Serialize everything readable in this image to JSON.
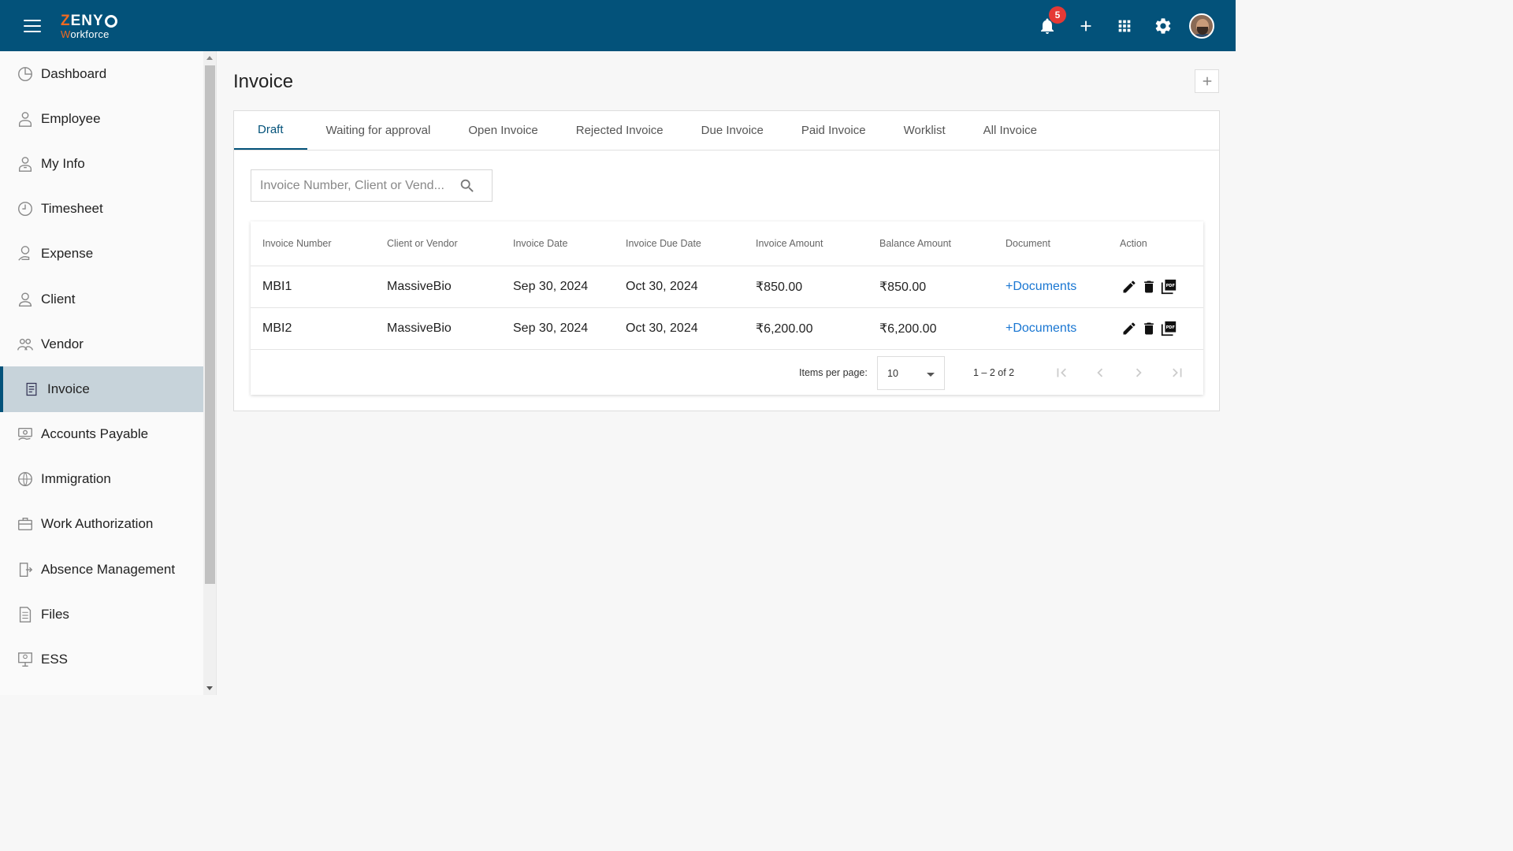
{
  "app": {
    "logo_brand": "ZENYO",
    "logo_sub": "Workforce",
    "notification_count": "5",
    "icons": [
      "menu-icon",
      "bell-icon",
      "plus-icon",
      "apps-grid-icon",
      "gear-icon",
      "avatar"
    ]
  },
  "sidebar": {
    "items": [
      {
        "label": "Dashboard",
        "icon": "dashboard-icon"
      },
      {
        "label": "Employee",
        "icon": "employee-icon"
      },
      {
        "label": "My Info",
        "icon": "my-info-icon"
      },
      {
        "label": "Timesheet",
        "icon": "clock-icon"
      },
      {
        "label": "Expense",
        "icon": "expense-icon"
      },
      {
        "label": "Client",
        "icon": "person-icon"
      },
      {
        "label": "Vendor",
        "icon": "vendor-icon"
      },
      {
        "label": "Invoice",
        "icon": "invoice-icon",
        "active": true
      },
      {
        "label": "Accounts Payable",
        "icon": "accounts-payable-icon"
      },
      {
        "label": "Immigration",
        "icon": "globe-icon"
      },
      {
        "label": "Work Authorization",
        "icon": "briefcase-icon"
      },
      {
        "label": "Absence Management",
        "icon": "exit-door-icon"
      },
      {
        "label": "Files",
        "icon": "file-icon"
      },
      {
        "label": "ESS",
        "icon": "ess-icon"
      }
    ]
  },
  "main": {
    "title": "Invoice",
    "tabs": [
      "Draft",
      "Waiting for approval",
      "Open Invoice",
      "Rejected Invoice",
      "Due Invoice",
      "Paid Invoice",
      "Worklist",
      "All Invoice"
    ],
    "active_tab": "Draft",
    "search": {
      "placeholder": "Invoice Number, Client or Vend...",
      "value": ""
    },
    "table": {
      "columns": [
        "Invoice Number",
        "Client or Vendor",
        "Invoice Date",
        "Invoice Due Date",
        "Invoice Amount",
        "Balance Amount",
        "Document",
        "Action"
      ],
      "rows": [
        {
          "number": "MBI1",
          "client": "MassiveBio",
          "date": "Sep 30, 2024",
          "due": "Oct 30, 2024",
          "amount": "₹850.00",
          "balance": "₹850.00",
          "document": "+Documents"
        },
        {
          "number": "MBI2",
          "client": "MassiveBio",
          "date": "Sep 30, 2024",
          "due": "Oct 30, 2024",
          "amount": "₹6,200.00",
          "balance": "₹6,200.00",
          "document": "+Documents"
        }
      ]
    },
    "paginator": {
      "items_per_page_label": "Items per page:",
      "items_per_page": "10",
      "range": "1 – 2 of 2"
    }
  },
  "colors": {
    "topbar": "#03527a",
    "brand_accent": "#f26a21",
    "link": "#1976d2",
    "sidebar_active": "#c7d3da"
  }
}
